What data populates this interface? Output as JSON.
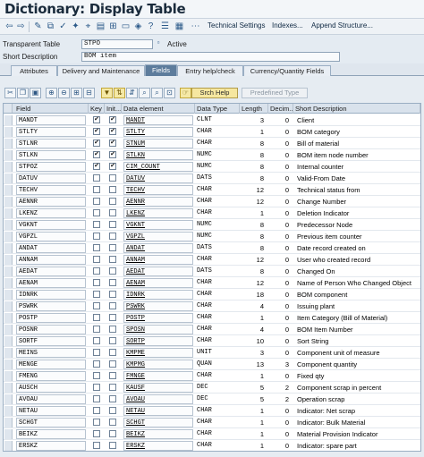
{
  "window": {
    "title": "Dictionary: Display Table"
  },
  "toolbar": {
    "technical_settings": "Technical Settings",
    "indexes": "Indexes...",
    "append_structure": "Append Structure..."
  },
  "header": {
    "type_label": "Transparent Table",
    "table_name": "STPO",
    "status": "Active",
    "short_desc_label": "Short Description",
    "short_desc": "BOM item"
  },
  "tabs": [
    {
      "label": "Attributes",
      "active": false
    },
    {
      "label": "Delivery and Maintenance",
      "active": false
    },
    {
      "label": "Fields",
      "active": true
    },
    {
      "label": "Entry help/check",
      "active": false
    },
    {
      "label": "Currency/Quantity Fields",
      "active": false
    }
  ],
  "field_toolbar": {
    "search_help": "Srch Help",
    "predefined_type": "Predefined Type"
  },
  "columns": [
    "Field",
    "Key",
    "Init...",
    "Data element",
    "Data Type",
    "Length",
    "Decim...",
    "Short Description"
  ],
  "rows": [
    {
      "field": "MANDT",
      "key": true,
      "init": true,
      "elem": "MANDT",
      "type": "CLNT",
      "len": "3",
      "dec": "0",
      "desc": "Client"
    },
    {
      "field": "STLTY",
      "key": true,
      "init": true,
      "elem": "STLTY",
      "type": "CHAR",
      "len": "1",
      "dec": "0",
      "desc": "BOM category"
    },
    {
      "field": "STLNR",
      "key": true,
      "init": true,
      "elem": "STNUM",
      "type": "CHAR",
      "len": "8",
      "dec": "0",
      "desc": "Bill of material"
    },
    {
      "field": "STLKN",
      "key": true,
      "init": true,
      "elem": "STLKN",
      "type": "NUMC",
      "len": "8",
      "dec": "0",
      "desc": "BOM item node number"
    },
    {
      "field": "STPOZ",
      "key": true,
      "init": true,
      "elem": "CIM_COUNT",
      "type": "NUMC",
      "len": "8",
      "dec": "0",
      "desc": "Internal counter"
    },
    {
      "field": "DATUV",
      "key": false,
      "init": false,
      "elem": "DATUV",
      "type": "DATS",
      "len": "8",
      "dec": "0",
      "desc": "Valid-From Date"
    },
    {
      "field": "TECHV",
      "key": false,
      "init": false,
      "elem": "TECHV",
      "type": "CHAR",
      "len": "12",
      "dec": "0",
      "desc": "Technical status from"
    },
    {
      "field": "AENNR",
      "key": false,
      "init": false,
      "elem": "AENNR",
      "type": "CHAR",
      "len": "12",
      "dec": "0",
      "desc": "Change Number"
    },
    {
      "field": "LKENZ",
      "key": false,
      "init": false,
      "elem": "LKENZ",
      "type": "CHAR",
      "len": "1",
      "dec": "0",
      "desc": "Deletion Indicator"
    },
    {
      "field": "VGKNT",
      "key": false,
      "init": false,
      "elem": "VGKNT",
      "type": "NUMC",
      "len": "8",
      "dec": "0",
      "desc": "Predecessor Node"
    },
    {
      "field": "VGPZL",
      "key": false,
      "init": false,
      "elem": "VGPZL",
      "type": "NUMC",
      "len": "8",
      "dec": "0",
      "desc": "Previous item counter"
    },
    {
      "field": "ANDAT",
      "key": false,
      "init": false,
      "elem": "ANDAT",
      "type": "DATS",
      "len": "8",
      "dec": "0",
      "desc": "Date record created on"
    },
    {
      "field": "ANNAM",
      "key": false,
      "init": false,
      "elem": "ANNAM",
      "type": "CHAR",
      "len": "12",
      "dec": "0",
      "desc": "User who created record"
    },
    {
      "field": "AEDAT",
      "key": false,
      "init": false,
      "elem": "AEDAT",
      "type": "DATS",
      "len": "8",
      "dec": "0",
      "desc": "Changed On"
    },
    {
      "field": "AENAM",
      "key": false,
      "init": false,
      "elem": "AENAM",
      "type": "CHAR",
      "len": "12",
      "dec": "0",
      "desc": "Name of Person Who Changed Object"
    },
    {
      "field": "IDNRK",
      "key": false,
      "init": false,
      "elem": "IDNRK",
      "type": "CHAR",
      "len": "18",
      "dec": "0",
      "desc": "BOM component"
    },
    {
      "field": "PSWRK",
      "key": false,
      "init": false,
      "elem": "PSWRK",
      "type": "CHAR",
      "len": "4",
      "dec": "0",
      "desc": "Issuing plant"
    },
    {
      "field": "POSTP",
      "key": false,
      "init": false,
      "elem": "POSTP",
      "type": "CHAR",
      "len": "1",
      "dec": "0",
      "desc": "Item Category (Bill of Material)"
    },
    {
      "field": "POSNR",
      "key": false,
      "init": false,
      "elem": "SPOSN",
      "type": "CHAR",
      "len": "4",
      "dec": "0",
      "desc": "BOM Item Number"
    },
    {
      "field": "SORTF",
      "key": false,
      "init": false,
      "elem": "SORTP",
      "type": "CHAR",
      "len": "10",
      "dec": "0",
      "desc": "Sort String"
    },
    {
      "field": "MEINS",
      "key": false,
      "init": false,
      "elem": "KMPME",
      "type": "UNIT",
      "len": "3",
      "dec": "0",
      "desc": "Component unit of measure"
    },
    {
      "field": "MENGE",
      "key": false,
      "init": false,
      "elem": "KMPMG",
      "type": "QUAN",
      "len": "13",
      "dec": "3",
      "desc": "Component quantity"
    },
    {
      "field": "FMENG",
      "key": false,
      "init": false,
      "elem": "FMNGE",
      "type": "CHAR",
      "len": "1",
      "dec": "0",
      "desc": "Fixed qty"
    },
    {
      "field": "AUSCH",
      "key": false,
      "init": false,
      "elem": "KAUSF",
      "type": "DEC",
      "len": "5",
      "dec": "2",
      "desc": "Component scrap in percent"
    },
    {
      "field": "AVOAU",
      "key": false,
      "init": false,
      "elem": "AVOAU",
      "type": "DEC",
      "len": "5",
      "dec": "2",
      "desc": "Operation scrap"
    },
    {
      "field": "NETAU",
      "key": false,
      "init": false,
      "elem": "NETAU",
      "type": "CHAR",
      "len": "1",
      "dec": "0",
      "desc": "Indicator: Net scrap"
    },
    {
      "field": "SCHGT",
      "key": false,
      "init": false,
      "elem": "SCHGT",
      "type": "CHAR",
      "len": "1",
      "dec": "0",
      "desc": "Indicator: Bulk Material"
    },
    {
      "field": "BEIKZ",
      "key": false,
      "init": false,
      "elem": "BEIKZ",
      "type": "CHAR",
      "len": "1",
      "dec": "0",
      "desc": "Material Provision Indicator"
    },
    {
      "field": "ERSKZ",
      "key": false,
      "init": false,
      "elem": "ERSKZ",
      "type": "CHAR",
      "len": "1",
      "dec": "0",
      "desc": "Indicator: spare part"
    }
  ]
}
